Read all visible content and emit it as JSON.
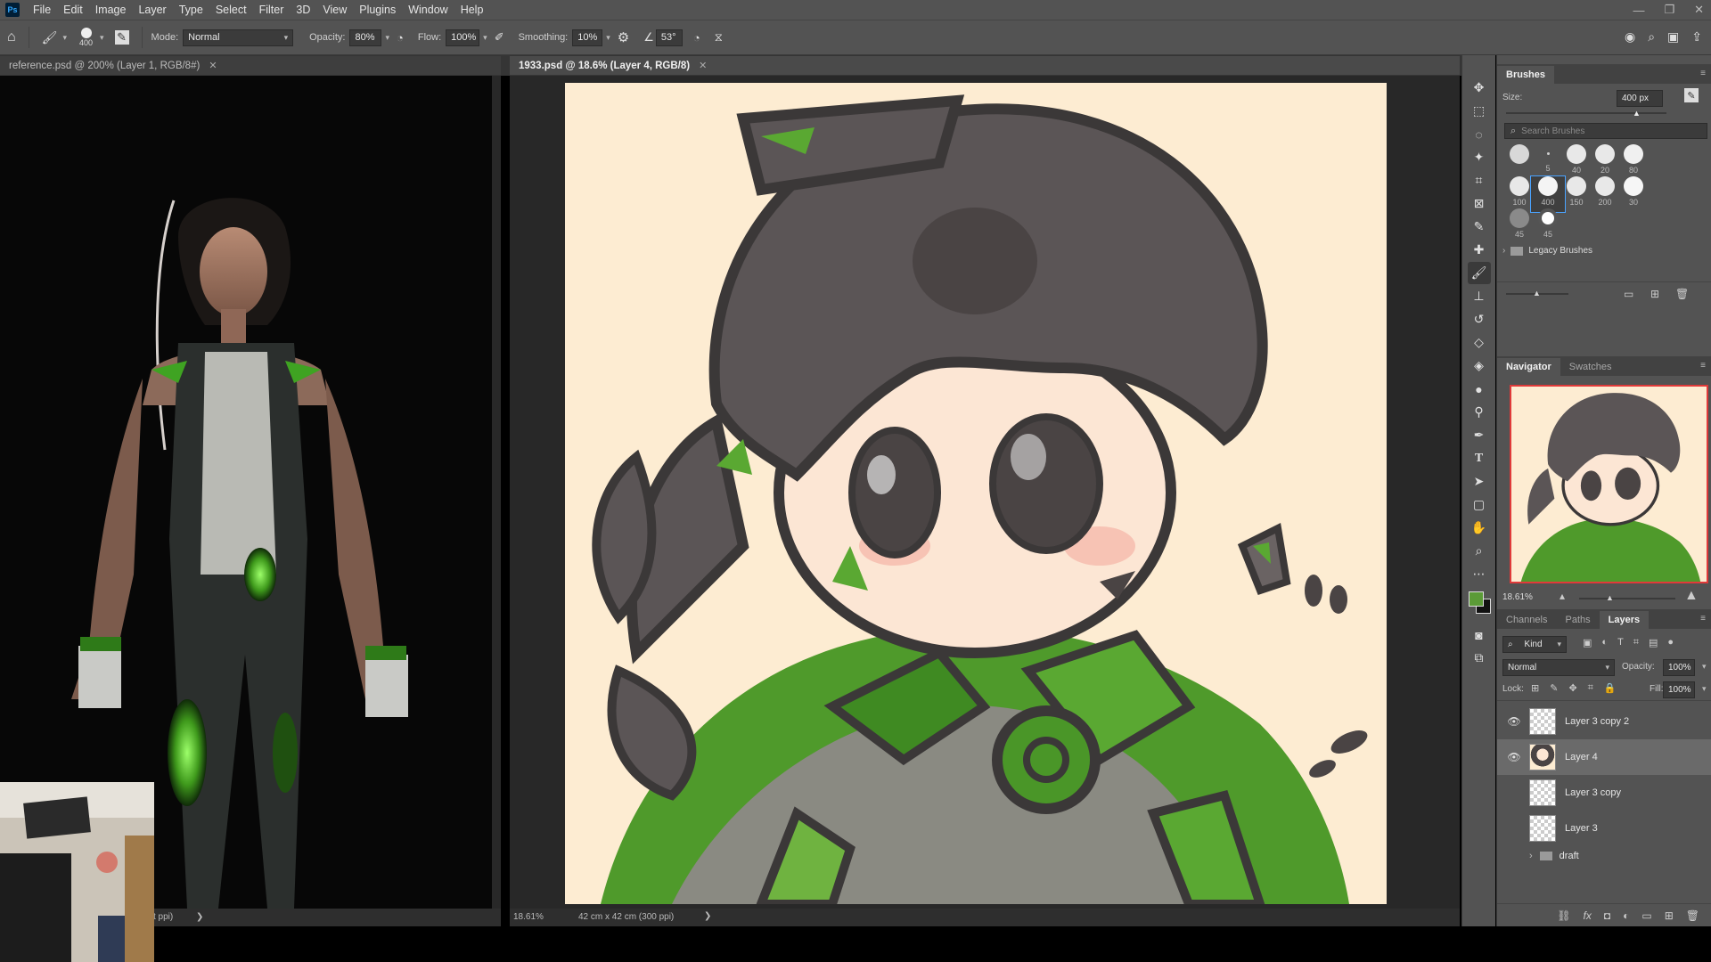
{
  "app": {
    "logo": "Ps"
  },
  "menu": [
    "File",
    "Edit",
    "Image",
    "Layer",
    "Type",
    "Select",
    "Filter",
    "3D",
    "View",
    "Plugins",
    "Window",
    "Help"
  ],
  "window_controls": {
    "minimize": "—",
    "restore": "❐",
    "close": "✕"
  },
  "options_bar": {
    "brush_size": "400",
    "mode_label": "Mode:",
    "mode_value": "Normal",
    "opacity_label": "Opacity:",
    "opacity_value": "80%",
    "flow_label": "Flow:",
    "flow_value": "100%",
    "smoothing_label": "Smoothing:",
    "smoothing_value": "10%",
    "angle_value": "53°"
  },
  "documents": [
    {
      "title": "reference.psd @ 200% (Layer 1, RGB/8#)",
      "active": false
    },
    {
      "title": "1933.psd @ 18.6% (Layer 4, RGB/8)",
      "active": true
    }
  ],
  "left_status": {
    "text": "t ppi)",
    "arrow": "❯"
  },
  "main_status": {
    "zoom": "18.61%",
    "dimensions": "42 cm x 42 cm (300 ppi)",
    "arrow": "❯"
  },
  "tools": [
    "move-icon",
    "marquee-icon",
    "lasso-icon",
    "magic-wand-icon",
    "crop-icon",
    "frame-icon",
    "eyedropper-icon",
    "healing-icon",
    "brush-icon",
    "stamp-icon",
    "history-brush-icon",
    "eraser-icon",
    "bucket-icon",
    "blur-icon",
    "dodge-icon",
    "pen-icon",
    "type-icon",
    "path-select-icon",
    "shape-icon",
    "hand-icon",
    "zoom-icon",
    "more-icon"
  ],
  "colors": {
    "foreground": "#5b9b37",
    "background": "#111111",
    "ui_bg": "#535353",
    "canvas_bg": "#fdecd2",
    "accent": "#4aa3ff"
  },
  "brushes_panel": {
    "tab": "Brushes",
    "size_label": "Size:",
    "size_value": "400 px",
    "search_placeholder": "Search Brushes",
    "presets": [
      {
        "size": "",
        "selected": false
      },
      {
        "size": "5",
        "selected": false
      },
      {
        "size": "40",
        "selected": false
      },
      {
        "size": "20",
        "selected": false
      },
      {
        "size": "80",
        "selected": false
      },
      {
        "size": "100",
        "selected": false
      },
      {
        "size": "400",
        "selected": true
      },
      {
        "size": "150",
        "selected": false
      },
      {
        "size": "200",
        "selected": false
      },
      {
        "size": "30",
        "selected": false
      },
      {
        "size": "45",
        "selected": false
      },
      {
        "size": "45",
        "selected": false
      }
    ],
    "legacy_folder": "Legacy Brushes"
  },
  "navigator_panel": {
    "tabs": [
      "Navigator",
      "Swatches"
    ],
    "zoom": "18.61%"
  },
  "layers_panel": {
    "tabs": [
      "Channels",
      "Paths",
      "Layers"
    ],
    "filter_label": "Kind",
    "blend_mode": "Normal",
    "opacity_label": "Opacity:",
    "opacity_value": "100%",
    "lock_label": "Lock:",
    "fill_label": "Fill:",
    "fill_value": "100%",
    "layers": [
      {
        "name": "Layer 3 copy 2",
        "visible": true,
        "selected": false
      },
      {
        "name": "Layer 4",
        "visible": true,
        "selected": true
      },
      {
        "name": "Layer 3 copy",
        "visible": false,
        "selected": false
      },
      {
        "name": "Layer 3",
        "visible": false,
        "selected": false
      },
      {
        "name": "draft",
        "visible": false,
        "selected": false
      }
    ]
  }
}
